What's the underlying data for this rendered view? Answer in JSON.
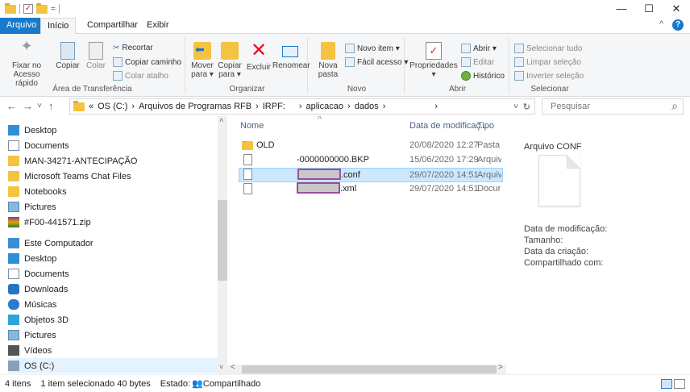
{
  "titlebar": {
    "qat_symbol": "=",
    "controls": {
      "minimize": "—",
      "maximize": "☐",
      "close": "✕"
    }
  },
  "ribbon_tabs": [
    "Arquivo",
    "Início",
    "Compartilhar",
    "Exibir"
  ],
  "ribbon_help": {
    "collapse": "^",
    "help": "?"
  },
  "ribbon": {
    "clipboard": {
      "pin_line1": "Fixar no",
      "pin_line2": "Acesso rápido",
      "copy": "Copiar",
      "paste": "Colar",
      "cut": "Recortar",
      "copy_path": "Copiar caminho",
      "paste_shortcut": "Colar atalho",
      "label": "Área de Transferência"
    },
    "organize": {
      "move_line1": "Mover",
      "move_line2": "para ▾",
      "copy_line1": "Copiar",
      "copy_line2": "para ▾",
      "delete": "Excluir",
      "rename": "Renomear",
      "label": "Organizar"
    },
    "new": {
      "folder_line1": "Nova",
      "folder_line2": "pasta",
      "new_item": "Novo item ▾",
      "easy_access": "Fácil acesso ▾",
      "label": "Novo"
    },
    "open": {
      "properties": "Propriedades",
      "properties_caret": "▾",
      "open": "Abrir ▾",
      "edit": "Editar",
      "history": "Histórico",
      "label": "Abrir"
    },
    "select": {
      "select_all": "Selecionar tudo",
      "clear": "Limpar seleção",
      "invert": "Inverter seleção",
      "label": "Selecionar"
    }
  },
  "address": {
    "breadcrumbs": [
      "«",
      "OS (C:)",
      "›",
      "Arquivos de Programas RFB",
      "›",
      "IRPF:",
      "›",
      "aplicacao",
      "›",
      "dados",
      "›"
    ],
    "trail": "›",
    "search_placeholder": "Pesquisar",
    "nav": {
      "back": "←",
      "forward": "→",
      "recent": "˅",
      "up": "↑",
      "dropdown": "˅",
      "refresh": "↻",
      "search_icon": "⌕"
    }
  },
  "nav_pane": [
    {
      "label": "Desktop",
      "icon": "desktop-icon"
    },
    {
      "label": "Documents",
      "icon": "documents-icon"
    },
    {
      "label": "MAN-34271-ANTECIPAÇÃO",
      "icon": "folder-icon"
    },
    {
      "label": "Microsoft Teams Chat Files",
      "icon": "folder-icon"
    },
    {
      "label": "Notebooks",
      "icon": "folder-icon"
    },
    {
      "label": "Pictures",
      "icon": "pictures-icon"
    },
    {
      "label": "#F00-441571.zip",
      "icon": "zip-icon"
    },
    {
      "label": "Este Computador",
      "icon": "computer-icon"
    },
    {
      "label": "Desktop",
      "icon": "desktop-icon"
    },
    {
      "label": "Documents",
      "icon": "documents-icon"
    },
    {
      "label": "Downloads",
      "icon": "downloads-icon"
    },
    {
      "label": "Músicas",
      "icon": "music-icon"
    },
    {
      "label": "Objetos 3D",
      "icon": "objects3d-icon"
    },
    {
      "label": "Pictures",
      "icon": "pictures-icon"
    },
    {
      "label": "Vídeos",
      "icon": "videos-icon"
    },
    {
      "label": "OS (C:)",
      "icon": "drive-icon"
    }
  ],
  "scroll": {
    "up": "˄",
    "down": "˅",
    "left": "<",
    "right": ">"
  },
  "columns": {
    "name": "Nome",
    "sort_arrow": "^",
    "date": "Data de modificaç...",
    "type": "Tipo"
  },
  "files": [
    {
      "name": "OLD",
      "date": "20/08/2020 12:27",
      "type": "Pasta"
    },
    {
      "name": "-0000000000.BKP",
      "date": "15/06/2020 17:29",
      "type": "Arquiv"
    },
    {
      "name": ".conf",
      "date": "29/07/2020 14:51",
      "type": "Arquiv"
    },
    {
      "name": ".xml",
      "date": "29/07/2020 14:51",
      "type": "Docur"
    }
  ],
  "preview": {
    "title": "Arquivo CONF",
    "modified": "Data de modificação:",
    "size": "Tamanho:",
    "created": "Data da criação:",
    "shared": "Compartilhado com:"
  },
  "status": {
    "count": "4 itens",
    "selection": "1 item selecionado  40 bytes",
    "state": "Estado:",
    "shared": "Compartilhado"
  },
  "colors": {
    "accent": "#1979ca",
    "selection": "#cce8ff",
    "folder": "#f5c342",
    "delete_x": "#e81123",
    "redact_border": "#9b4f9c"
  }
}
